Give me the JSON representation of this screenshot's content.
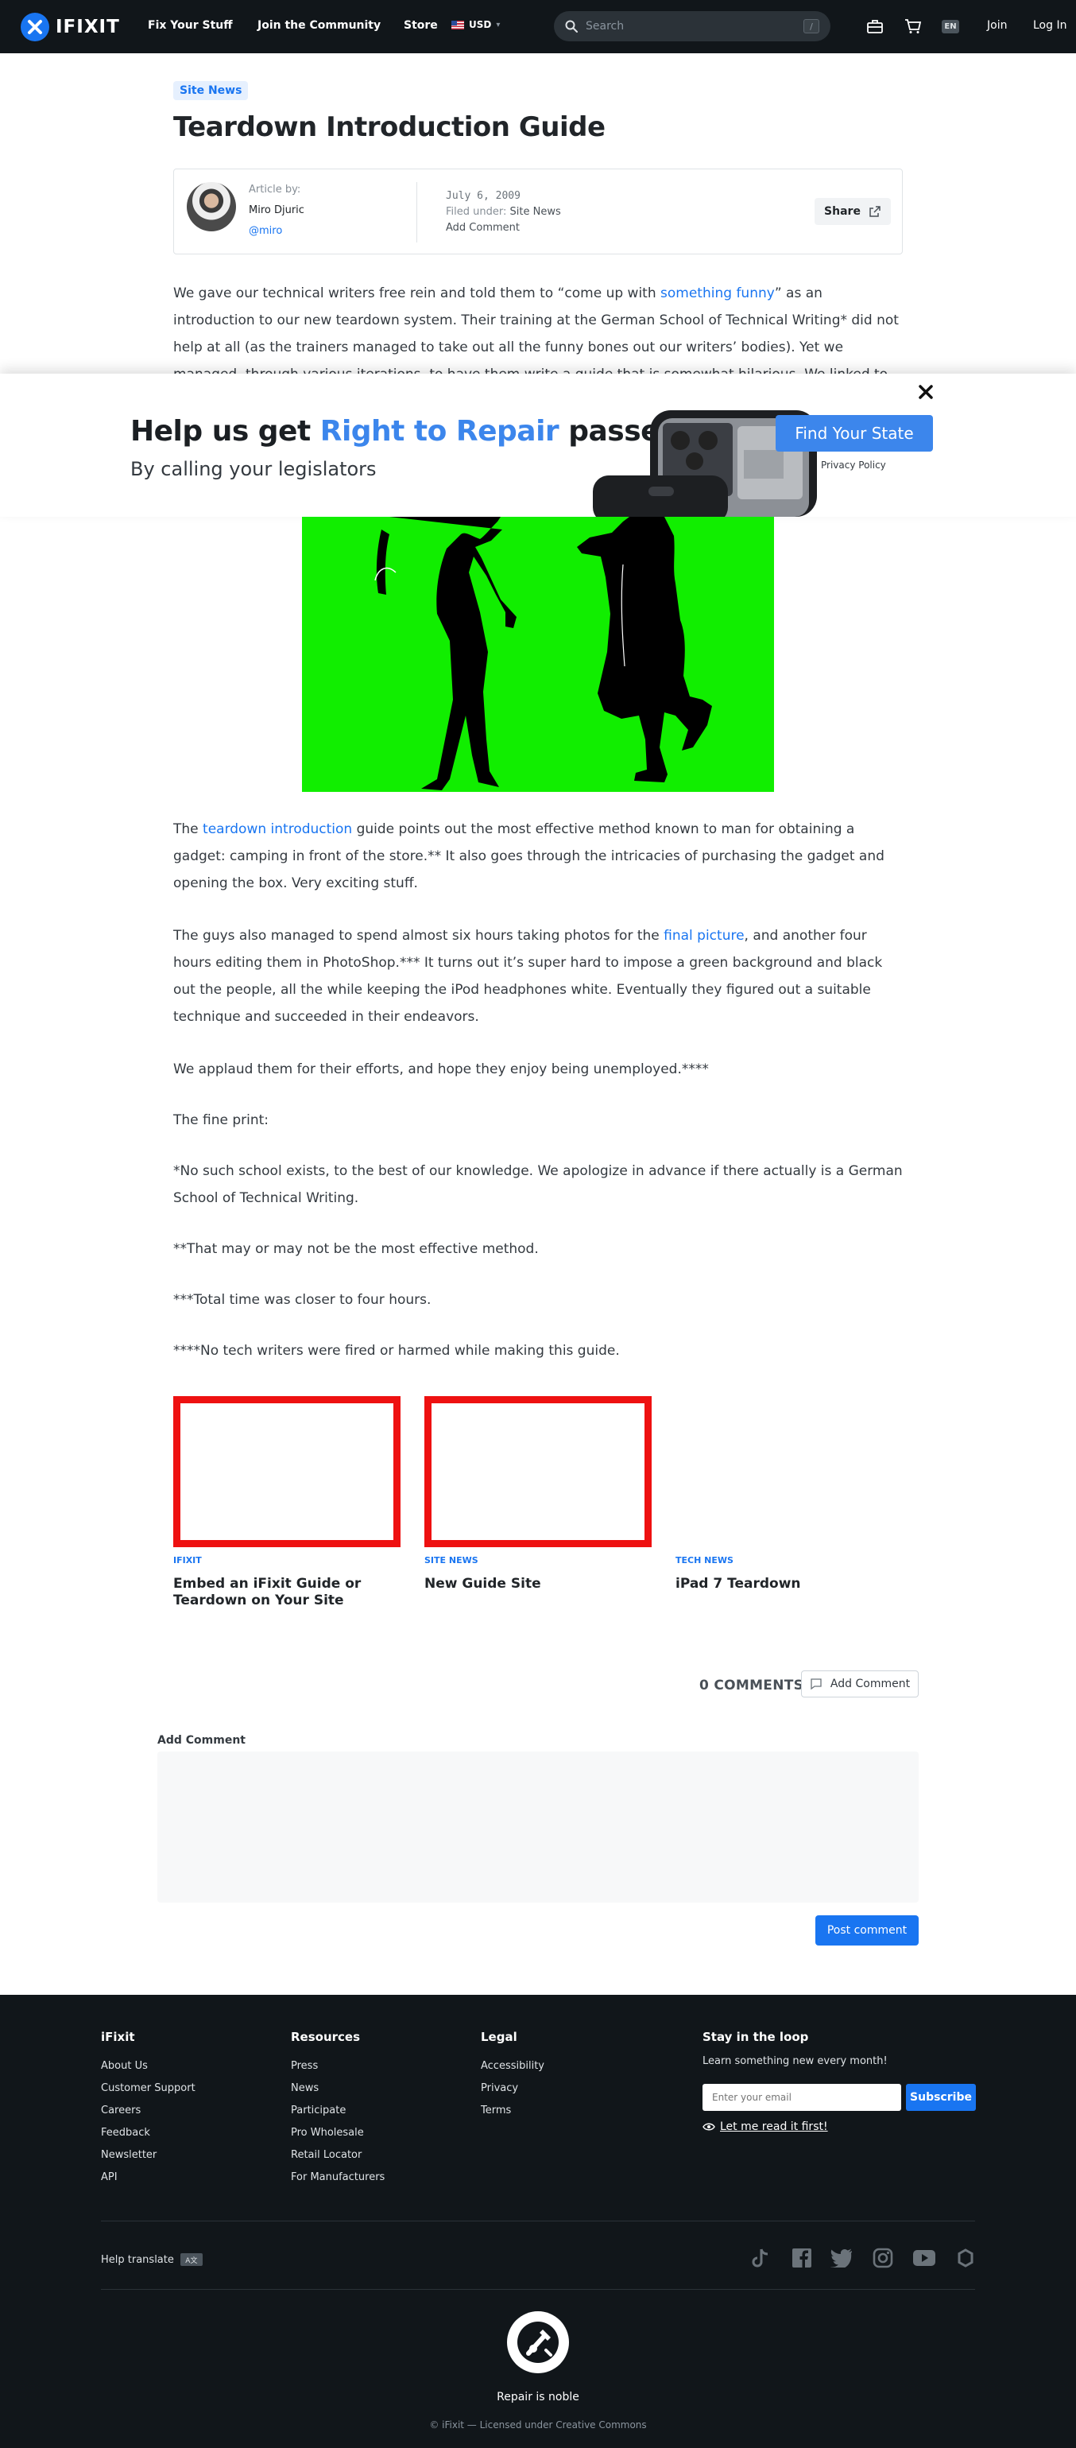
{
  "header": {
    "logo_text": "IFIXIT",
    "nav": [
      "Fix Your Stuff",
      "Join the Community",
      "Store"
    ],
    "currency": "USD",
    "search_placeholder": "Search",
    "search_shortcut": "/",
    "language": "EN",
    "join": "Join",
    "login": "Log In",
    "icons": [
      "toolbox-icon",
      "cart-icon"
    ]
  },
  "article": {
    "category": "Site News",
    "title": "Teardown Introduction Guide",
    "author_label": "Article by:",
    "author_name": "Miro Djuric",
    "author_handle": "@miro",
    "date": "July 6, 2009",
    "filed_label": "Filed under:",
    "filed_value": "Site News",
    "add_comment": "Add Comment",
    "share": "Share",
    "intro_partial": {
      "p1a": "We gave our technical writers free rein and told them to “come up with ",
      "p1_link": "something funny",
      "p1b": "” as an introduction to our new teardown system. Their training at the German School of Technical Writing* did not help at all (as the trainers managed to take out all the funny bones out our writers’ bodies). Yet we managed, through various iterations, to have them write a guide that is somewhat hilarious. We linked to this guide when we"
    },
    "body": {
      "p2a": "The ",
      "p2_link": "teardown introduction",
      "p2b": " guide points out the most effective method known to man for obtaining a gadget: camping in front of the store.**  It also goes through the intricacies of purchasing the gadget and opening the box. Very exciting stuff.",
      "p3a": "The guys also managed to spend almost six hours taking photos for the ",
      "p3_link": "final picture",
      "p3b": ", and another four hours editing them in PhotoShop.*** It turns out it’s super hard to impose a green background and black out the people, all the while keeping the iPod headphones white. Eventually they figured out a suitable technique and succeeded in their endeavors.",
      "p4": "We applaud them for their efforts, and hope they enjoy being unemployed.****",
      "p5": "The fine print:",
      "p6": "*No such school exists, to the best of our knowledge. We apologize in advance if there actually is a German School of Technical Writing.",
      "p7": "**That may or may not be the most effective method.",
      "p8": "***Total time was closer to four hours.",
      "p9": "****No tech writers were fired or harmed while making this guide."
    }
  },
  "banner": {
    "heading_pre": "Help us get ",
    "heading_highlight": "Right to Repair",
    "heading_post": " passed",
    "subheading": "By calling your legislators",
    "cta": "Find Your State",
    "privacy": "Privacy Policy"
  },
  "related": [
    {
      "category": "IFIXIT",
      "title": "Embed an iFixit Guide or Teardown on Your Site"
    },
    {
      "category": "SITE NEWS",
      "title": "New Guide Site"
    },
    {
      "category": "TECH NEWS",
      "title": "iPad 7 Teardown"
    }
  ],
  "comments": {
    "count": "0 COMMENTS",
    "add_button": "Add Comment",
    "form_label": "Add Comment",
    "post_button": "Post comment"
  },
  "footer": {
    "col1": {
      "heading": "iFixit",
      "links": [
        "About Us",
        "Customer Support",
        "Careers",
        "Feedback",
        "Newsletter",
        "API"
      ]
    },
    "col2": {
      "heading": "Resources",
      "links": [
        "Press",
        "News",
        "Participate",
        "Pro Wholesale",
        "Retail Locator",
        "For Manufacturers"
      ]
    },
    "col3": {
      "heading": "Legal",
      "links": [
        "Accessibility",
        "Privacy",
        "Terms"
      ]
    },
    "newsletter": {
      "heading": "Stay in the loop",
      "subtext": "Learn something new every month!",
      "email_placeholder": "Enter your email",
      "subscribe": "Subscribe",
      "read_first": "Let me read it first!"
    },
    "help_translate": "Help translate",
    "social": [
      "tiktok-icon",
      "facebook-icon",
      "twitter-icon",
      "instagram-icon",
      "youtube-icon",
      "repair-org-icon"
    ],
    "tagline": "Repair is noble",
    "copyright": "© iFixit — Licensed under Creative Commons"
  },
  "colors": {
    "accent": "#1975f1",
    "banner_blue": "#3c86ec",
    "footer_bg": "#11161a",
    "hero_green": "#11ee00",
    "thumb_red": "#ee1111"
  }
}
